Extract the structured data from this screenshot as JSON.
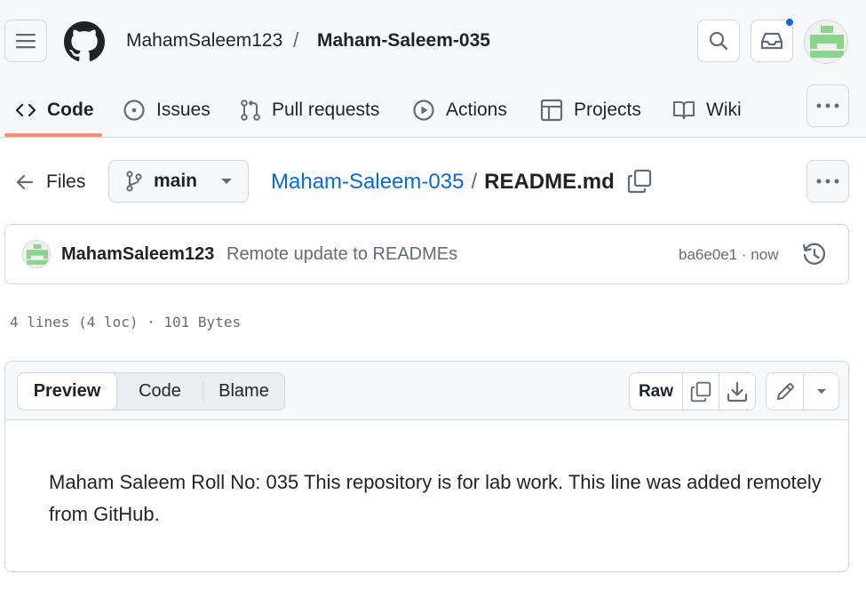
{
  "header": {
    "owner": "MahamSaleem123",
    "separator": "/",
    "repo": "Maham-Saleem-035",
    "colors": {
      "accent": "#0969da",
      "tab_underline": "#fd8c73",
      "avatar_green": "#8bd48b"
    }
  },
  "nav_tabs": [
    {
      "label": "Code",
      "icon": "code-icon"
    },
    {
      "label": "Issues",
      "icon": "issue-opened-icon"
    },
    {
      "label": "Pull requests",
      "icon": "git-pull-request-icon"
    },
    {
      "label": "Actions",
      "icon": "play-icon"
    },
    {
      "label": "Projects",
      "icon": "table-icon"
    },
    {
      "label": "Wiki",
      "icon": "book-icon"
    }
  ],
  "file_nav": {
    "back_label": "Files",
    "branch": "main",
    "breadcrumb_repo": "Maham-Saleem-035",
    "breadcrumb_sep": "/",
    "file_name": "README.md"
  },
  "commit": {
    "author": "MahamSaleem123",
    "message": "Remote update to READMEs",
    "sha_time": "ba6e0e1 · now"
  },
  "file_info": "4 lines (4 loc) · 101 Bytes",
  "view_tabs": [
    "Preview",
    "Code",
    "Blame"
  ],
  "toolbar": {
    "raw_label": "Raw"
  },
  "readme": {
    "text": "Maham Saleem Roll No: 035 This repository is for lab work. This line was added remotely from GitHub."
  }
}
